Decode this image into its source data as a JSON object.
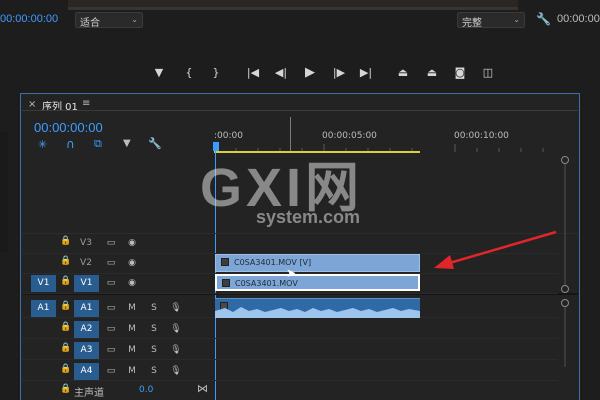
{
  "monitor": {
    "timecode_left": "00:00:00:00",
    "fit_label": "适合",
    "quality_label": "完整",
    "timecode_right": "00:00:00"
  },
  "transport": {
    "buttons": [
      "add-marker",
      "mark-in",
      "mark-out",
      "go-to-in",
      "step-back",
      "play",
      "step-forward",
      "go-to-out",
      "lift",
      "extract",
      "export-frame",
      "compare"
    ]
  },
  "sequence": {
    "close": "×",
    "title": "序列 01",
    "menu": "≡",
    "timecode": "00:00:00:00"
  },
  "ruler": {
    "ticks": [
      ":00:00",
      "00:00:05:00",
      "00:00:10:00"
    ]
  },
  "tracks": {
    "video": [
      {
        "source": "",
        "name": "V3"
      },
      {
        "source": "",
        "name": "V2"
      },
      {
        "source": "V1",
        "name": "V1"
      }
    ],
    "audio": [
      {
        "source": "A1",
        "name": "A1",
        "m": "M",
        "s": "S"
      },
      {
        "source": "",
        "name": "A2",
        "m": "M",
        "s": "S"
      },
      {
        "source": "",
        "name": "A3",
        "m": "M",
        "s": "S"
      },
      {
        "source": "",
        "name": "A4",
        "m": "M",
        "s": "S"
      }
    ],
    "master": {
      "label": "主声道",
      "value": "0.0"
    }
  },
  "clips": {
    "v2_clip": "C0SA3401.MOV [V]",
    "v1_clip": "C0SA3401.MOV"
  },
  "watermark": {
    "logo": "GXI网",
    "domain": "system.com"
  },
  "colors": {
    "timecode": "#3f9cff",
    "track_target": "#2a5d8f",
    "clip": "#7da6d6",
    "arrow": "#e0252b",
    "work_area": "#d9cf3a"
  }
}
